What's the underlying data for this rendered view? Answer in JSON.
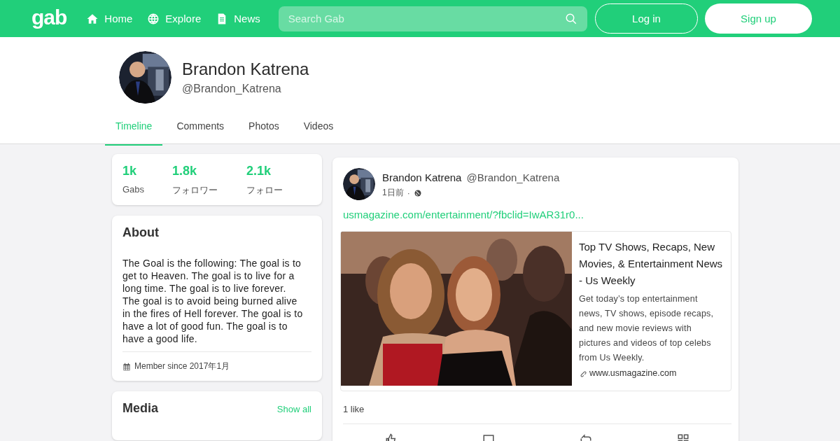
{
  "nav": {
    "logo": "gab",
    "links": [
      {
        "label": "Home"
      },
      {
        "label": "Explore"
      },
      {
        "label": "News"
      }
    ],
    "search": {
      "placeholder": "Search Gab"
    },
    "buttons": [
      {
        "label": "Log in",
        "kind": "outline"
      },
      {
        "label": "Sign up",
        "kind": "solid"
      }
    ]
  },
  "profile": {
    "name": "Brandon Katrena",
    "handle": "@Brandon_Katrena"
  },
  "tabs": [
    {
      "label": "Timeline",
      "selected": true
    },
    {
      "label": "Comments",
      "selected": false
    },
    {
      "label": "Photos",
      "selected": false
    },
    {
      "label": "Videos",
      "selected": false
    }
  ],
  "stats": [
    {
      "value": "1k",
      "label": "Gabs"
    },
    {
      "value": "1.8k",
      "label": "フォロワー"
    },
    {
      "value": "2.1k",
      "label": "フォロー"
    }
  ],
  "about": {
    "title": "About",
    "text": "The Goal is the following: The goal is to get to Heaven. The goal is to live for a long time. The goal is to live forever. The goal is to avoid being burned alive in the fires of Hell forever. The goal is to have a lot of good fun. The goal is to have a good life.",
    "member_since": "Member since 2017年1月"
  },
  "media": {
    "title": "Media",
    "show_all": "Show all"
  },
  "post": {
    "name": "Brandon Katrena",
    "handle": "@Brandon_Katrena",
    "time": "1日前",
    "separator": "·",
    "link": "usmagazine.com/entertainment/?fbclid=IwAR31r0...",
    "preview": {
      "title": "Top TV Shows, Recaps, New Movies, & Entertainment News - Us Weekly",
      "description": "Get today’s top entertainment news, TV shows, episode recaps, and new movie reviews with pictures and videos of top celebs from Us Weekly.",
      "domain": "www.usmagazine.com"
    },
    "likes": "1 like"
  }
}
